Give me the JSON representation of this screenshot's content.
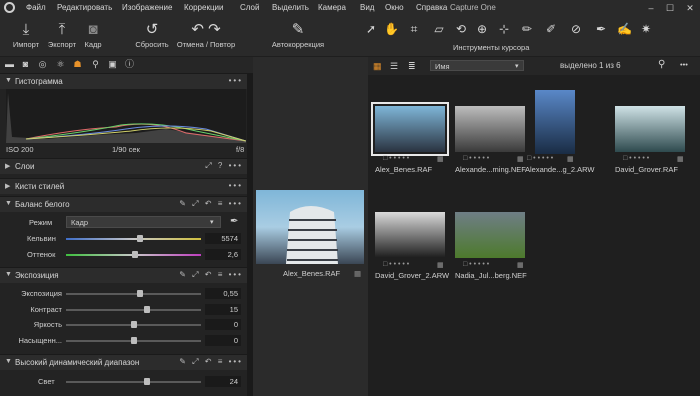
{
  "menu": {
    "items": [
      "Файл",
      "Редактировать",
      "Изображение",
      "Коррекции",
      "Слой",
      "Выделить",
      "Камера",
      "Вид",
      "Окно",
      "Справка"
    ],
    "app_title": "Capture One",
    "minimize": "–",
    "maximize": "☐",
    "close": "✕"
  },
  "toolbar": {
    "import": "Импорт",
    "export": "Экспорт",
    "camera": "Кадр",
    "reset": "Сбросить",
    "undo_redo": "Отмена / Повтор",
    "autocorrect": "Автокоррекция",
    "cursor_tools": "Инструменты курсора"
  },
  "histogram": {
    "title": "Гистограмма",
    "iso": "ISO 200",
    "shutter": "1/90 сек",
    "aperture": "f/8"
  },
  "layers": {
    "title": "Слои"
  },
  "styles": {
    "title": "Кисти стилей"
  },
  "white_balance": {
    "title": "Баланс белого",
    "mode_label": "Режим",
    "mode_value": "Кадр",
    "kelvin_label": "Кельвин",
    "kelvin_value": "5574",
    "kelvin_level": 0.55,
    "tint_label": "Оттенок",
    "tint_value": "2,6",
    "tint_level": 0.51
  },
  "exposure": {
    "title": "Экспозиция",
    "rows": [
      {
        "label": "Экспозиция",
        "value": "0,55",
        "level": 0.55
      },
      {
        "label": "Контраст",
        "value": "15",
        "level": 0.6
      },
      {
        "label": "Яркость",
        "value": "0",
        "level": 0.5
      },
      {
        "label": "Насыщенн...",
        "value": "0",
        "level": 0.5
      }
    ]
  },
  "hdr": {
    "title": "Высокий динамический диапазон",
    "light_label": "Свет",
    "light_value": "24",
    "light_level": 0.6
  },
  "viewer": {
    "filename": "Alex_Benes.RAF"
  },
  "browser": {
    "sort": "Имя",
    "selection": "выделено 1 из 6",
    "thumbs": [
      {
        "name": "Alex_Benes.RAF",
        "colors": [
          "#7fb6d8",
          "#2a3340"
        ]
      },
      {
        "name": "Alexande...ming.NEF",
        "colors": [
          "#bdbdbd",
          "#3a3a3a"
        ]
      },
      {
        "name": "Alexande...g_2.ARW",
        "colors": [
          "#5a88c8",
          "#1a2c44"
        ]
      },
      {
        "name": "David_Grover.RAF",
        "colors": [
          "#cfe2e6",
          "#2e4a4e"
        ]
      },
      {
        "name": "David_Grover_2.ARW",
        "colors": [
          "#dadada",
          "#1d1d1d"
        ]
      },
      {
        "name": "Nadia_Jul...berg.NEF",
        "colors": [
          "#6f7e86",
          "#4d7a2c"
        ]
      }
    ]
  }
}
